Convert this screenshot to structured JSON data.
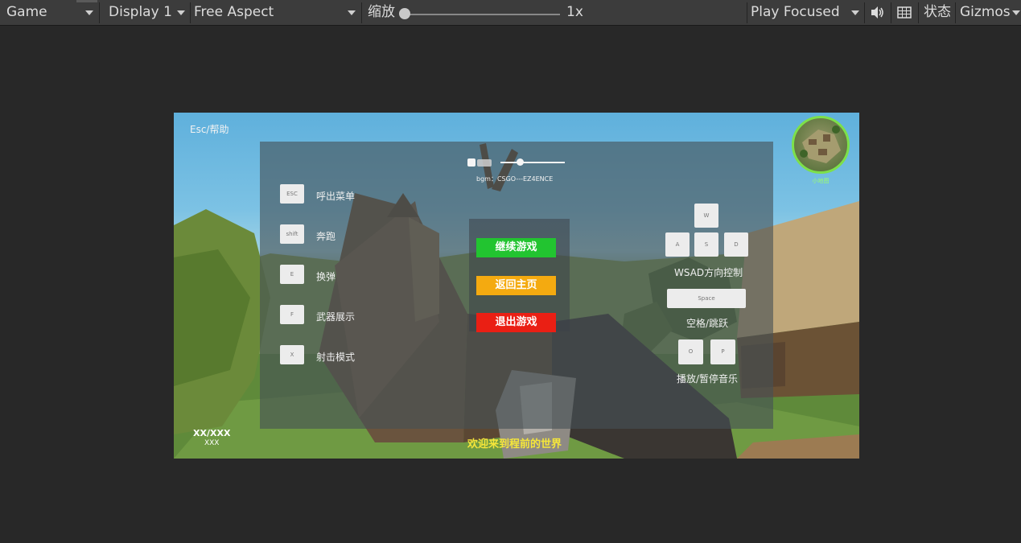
{
  "toolbar": {
    "view": "Game",
    "display": "Display 1",
    "aspect": "Free Aspect",
    "scale_label": "缩放",
    "scale_value": "1x",
    "play_mode": "Play Focused",
    "audio_icon": "speaker-icon",
    "stats_icon": "grid-icon",
    "stats_label": "状态",
    "gizmos": "Gizmos"
  },
  "hud": {
    "help_hint": "Esc/帮助",
    "minimap_label": "小地图",
    "ammo": "XX/XXX",
    "ammo_sub": "XXX",
    "welcome": "欢迎来到程前的世界"
  },
  "audio": {
    "bgm": "bgm：CSGO---EZ4ENCE",
    "volume": 0.3
  },
  "menu": {
    "continue": "继续游戏",
    "home": "返回主页",
    "quit": "退出游戏"
  },
  "controls_left": [
    {
      "key": "ESC",
      "label": "呼出菜单"
    },
    {
      "key": "shift",
      "label": "奔跑"
    },
    {
      "key": "E",
      "label": "换弹"
    },
    {
      "key": "F",
      "label": "武器展示"
    },
    {
      "key": "X",
      "label": "射击模式"
    }
  ],
  "controls_right": {
    "w": "W",
    "a": "A",
    "s": "S",
    "d": "D",
    "wsad_label": "WSAD方向控制",
    "space": "Space",
    "space_label": "空格/跳跃",
    "o": "O",
    "p": "P",
    "music_label": "播放/暂停音乐"
  },
  "colors": {
    "continue": "#22c430",
    "home": "#f4aa10",
    "quit": "#ea1f14",
    "welcome": "#f5e63a"
  }
}
